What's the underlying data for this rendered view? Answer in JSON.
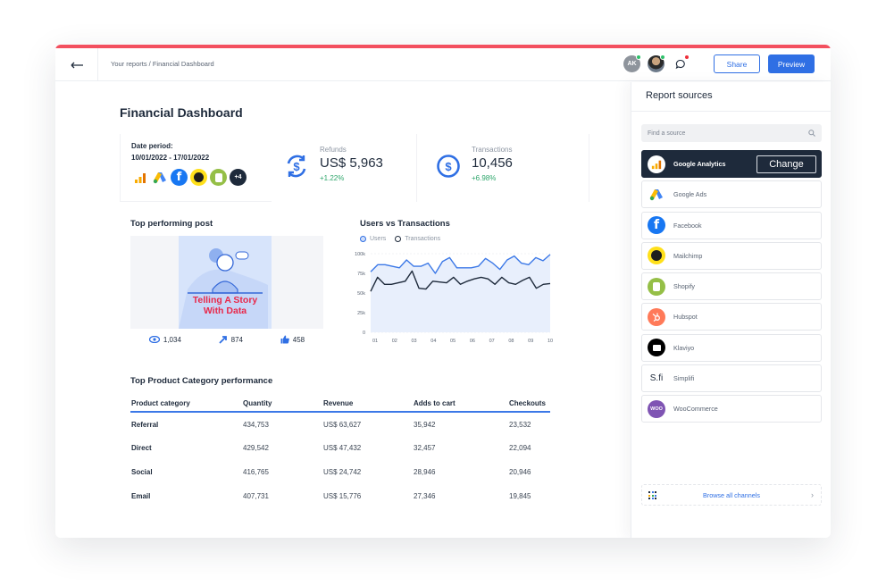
{
  "header": {
    "breadcrumb": "Your reports / Financial Dashboard",
    "avatar_initials": "AK",
    "share_label": "Share",
    "preview_label": "Preview"
  },
  "page": {
    "title": "Financial Dashboard"
  },
  "kpis": {
    "date_label": "Date period:",
    "date_range": "10/01/2022 - 17/01/2022",
    "sources_more": "+4",
    "refunds": {
      "title": "Refunds",
      "value": "US$ 5,963",
      "change": "+1.22%"
    },
    "transactions": {
      "title": "Transactions",
      "value": "10,456",
      "change": "+6.98%"
    }
  },
  "post": {
    "title": "Top performing post",
    "image_text_line1": "Telling A Story",
    "image_text_line2": "With Data",
    "views": "1,034",
    "shares": "874",
    "likes": "458"
  },
  "chart_data": {
    "type": "line",
    "title": "Users vs Transactions",
    "xlabel": "",
    "ylabel": "",
    "x_ticks": [
      "01",
      "02",
      "03",
      "04",
      "05",
      "06",
      "07",
      "08",
      "09",
      "10"
    ],
    "y_ticks": [
      "0",
      "25k",
      "50k",
      "75k",
      "100k"
    ],
    "ylim": [
      0,
      100000
    ],
    "legend": "top-left",
    "grid": true,
    "series": [
      {
        "name": "Users",
        "color": "#3b78e7",
        "area": true,
        "values": [
          77000,
          86000,
          86000,
          84000,
          82000,
          92000,
          84000,
          84000,
          88000,
          75000,
          90000,
          95000,
          82000,
          82000,
          82000,
          84000,
          94000,
          88000,
          80000,
          92000,
          97000,
          88000,
          86000,
          95000,
          91000,
          99000
        ]
      },
      {
        "name": "Transactions",
        "color": "#1e2a3b",
        "area": false,
        "values": [
          52000,
          70000,
          61000,
          61000,
          63000,
          65000,
          78000,
          56000,
          55000,
          65000,
          64000,
          63000,
          70000,
          61000,
          65000,
          68000,
          70000,
          68000,
          61000,
          70000,
          63000,
          61000,
          66000,
          70000,
          56000,
          61000,
          62000
        ]
      }
    ]
  },
  "table": {
    "title": "Top Product Category performance",
    "columns": [
      "Product category",
      "Quantity",
      "Revenue",
      "Adds to cart",
      "Checkouts"
    ],
    "rows": [
      [
        "Referral",
        "434,753",
        "US$ 63,627",
        "35,942",
        "23,532"
      ],
      [
        "Direct",
        "429,542",
        "US$ 47,432",
        "32,457",
        "22,094"
      ],
      [
        "Social",
        "416,765",
        "US$ 24,742",
        "28,946",
        "20,946"
      ],
      [
        "Email",
        "407,731",
        "US$ 15,776",
        "27,346",
        "19,845"
      ]
    ]
  },
  "sidebar": {
    "title": "Report sources",
    "search_placeholder": "Find a source",
    "change_label": "Change",
    "sources": [
      {
        "name": "Google Analytics",
        "icon": "google-analytics-icon",
        "active": true
      },
      {
        "name": "Google Ads",
        "icon": "google-ads-icon"
      },
      {
        "name": "Facebook",
        "icon": "facebook-icon"
      },
      {
        "name": "Mailchimp",
        "icon": "mailchimp-icon"
      },
      {
        "name": "Shopify",
        "icon": "shopify-icon"
      },
      {
        "name": "Hubspot",
        "icon": "hubspot-icon"
      },
      {
        "name": "Klaviyo",
        "icon": "klaviyo-icon"
      },
      {
        "name": "Simplifi",
        "icon": "simplifi-icon"
      },
      {
        "name": "WooCommerce",
        "icon": "woocommerce-icon"
      }
    ],
    "browse_label": "Browse all channels"
  },
  "colors": {
    "accent": "#2f6fe4",
    "top_bar": "#f3505f",
    "positive": "#2ea66b",
    "dark": "#1e2a3b"
  }
}
